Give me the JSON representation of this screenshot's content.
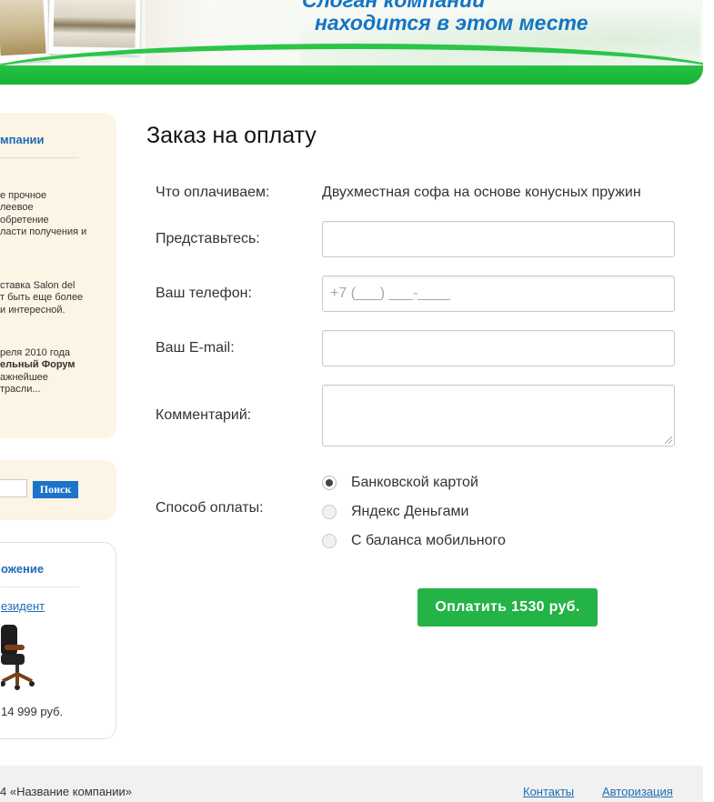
{
  "header": {
    "slogan_line1": "Слоган компании",
    "slogan_line2": "находится в этом месте",
    "accent_color": "#1474c4",
    "bar_color": "#1fb83c"
  },
  "sidebar": {
    "news": {
      "title": "мпании",
      "items": [
        {
          "text": "е прочное\nлеевое\nобретение\nласти получения и"
        },
        {
          "text": "ставка Salon del\nт быть еще более\nи интересной."
        },
        {
          "text_before": "реля 2010 года\n",
          "bold": "ельный Форум",
          "text_after": "\nажнейшее\nтрасли..."
        }
      ]
    },
    "search": {
      "button_label": "Поиск"
    },
    "offer": {
      "title": "ожение",
      "link": "езидент",
      "price": "14 999 руб."
    }
  },
  "main": {
    "title": "Заказ на оплату",
    "form": {
      "purpose_label": "Что оплачиваем:",
      "purpose_value": "Двухместная софа на основе конусных пружин",
      "name_label": "Представьтесь:",
      "name_value": "",
      "phone_label": "Ваш телефон:",
      "phone_placeholder": "+7 (___) ___-____",
      "email_label": "Ваш E-mail:",
      "email_value": "",
      "comment_label": "Комментарий:",
      "comment_value": "",
      "payment_label": "Способ оплаты:",
      "payment_options": [
        {
          "label": "Банковской картой",
          "checked": true
        },
        {
          "label": "Яндекс Деньгами",
          "checked": false
        },
        {
          "label": "С баланса мобильного",
          "checked": false
        }
      ],
      "submit_label": "Оплатить 1530 руб.",
      "submit_color": "#23b346"
    }
  },
  "footer": {
    "copyright": "4 «Название компании»",
    "links": [
      "Контакты",
      "Авторизация"
    ]
  }
}
